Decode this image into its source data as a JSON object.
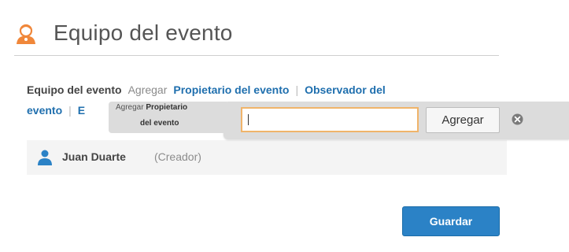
{
  "header": {
    "title": "Equipo del evento",
    "icon": "event-team-person-icon"
  },
  "tabs": {
    "current": "Equipo del evento",
    "add": "Agregar",
    "owner": "Propietario del evento",
    "separator": "|",
    "observer_line1": "Observador del",
    "observer_line2": "evento",
    "partial": "E"
  },
  "members": [
    {
      "name": "Juan Duarte",
      "role": "(Creador)",
      "icon": "user-icon"
    }
  ],
  "actions": {
    "save_label": "Guardar"
  },
  "add_popover": {
    "label_prefix": "Agregar",
    "label_bold_line1": "Propietario",
    "label_bold_line2": "del evento",
    "input_value": "",
    "add_label": "Agregar",
    "close_icon": "close-circle-icon"
  },
  "colors": {
    "link": "#1f6fae",
    "primary_button": "#2b82c6",
    "input_focus_border": "#f0b46a",
    "popover_bg": "#dcdcdc",
    "icon_orange": "#f0873a"
  }
}
